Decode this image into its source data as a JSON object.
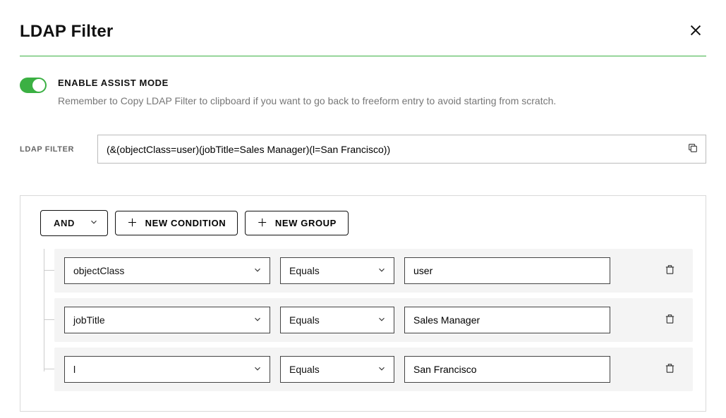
{
  "title": "LDAP Filter",
  "assist": {
    "label": "ENABLE ASSIST MODE",
    "hint": "Remember to Copy LDAP Filter to clipboard if you want to go back to freeform entry to avoid starting from scratch."
  },
  "filter": {
    "label": "LDAP FILTER",
    "value": "(&(objectClass=user)(jobTitle=Sales Manager)(l=San Francisco))"
  },
  "toolbar": {
    "combinator": "AND",
    "new_condition": "NEW CONDITION",
    "new_group": "NEW GROUP"
  },
  "conditions": [
    {
      "field": "objectClass",
      "op": "Equals",
      "value": "user"
    },
    {
      "field": "jobTitle",
      "op": "Equals",
      "value": "Sales Manager"
    },
    {
      "field": "l",
      "op": "Equals",
      "value": "San Francisco"
    }
  ]
}
